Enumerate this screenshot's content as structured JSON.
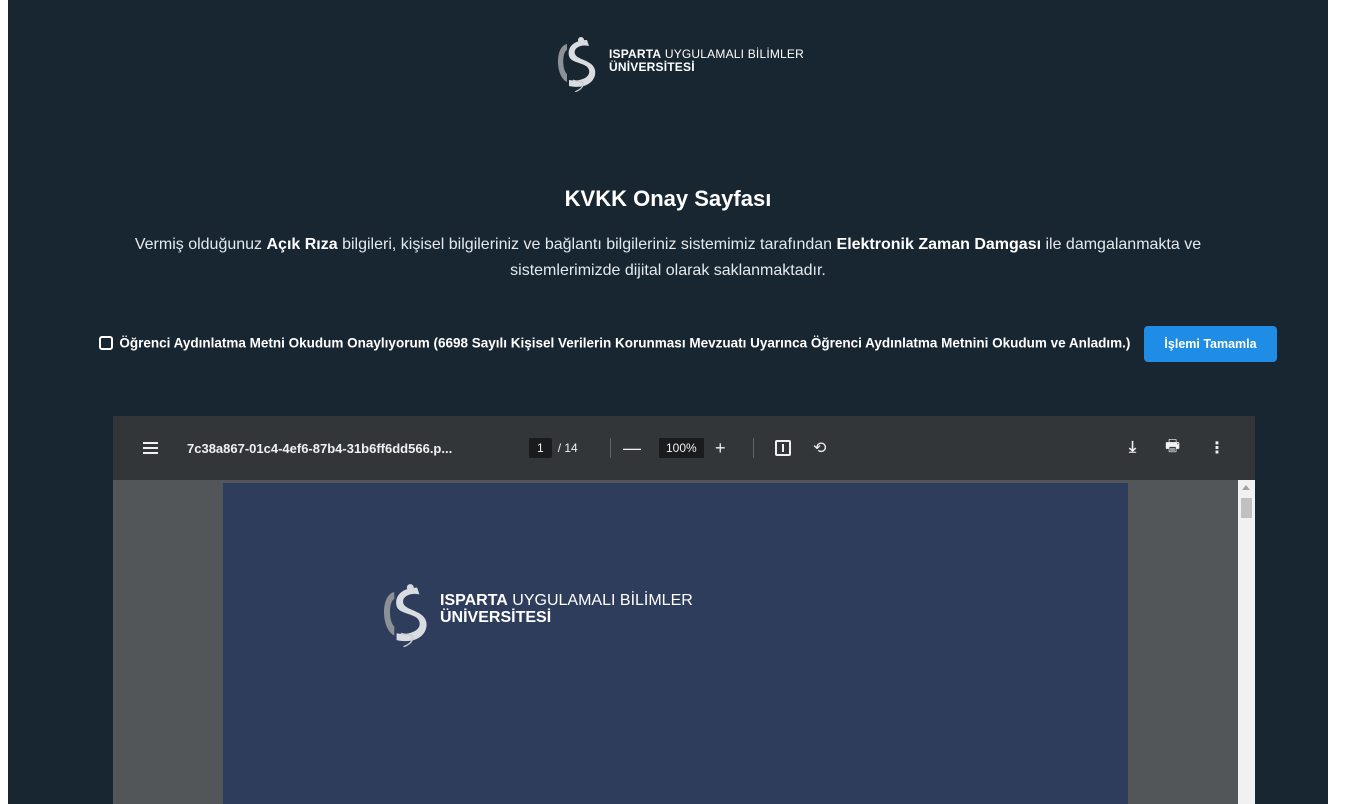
{
  "header": {
    "logo": {
      "line1_bold": "ISPARTA",
      "line1_rest": " UYGULAMALI BİLİMLER",
      "line2": "ÜNİVERSİTESİ"
    }
  },
  "main": {
    "title": "KVKK Onay Sayfası",
    "description": {
      "p1": "Vermiş olduğunuz ",
      "b1": "Açık Rıza",
      "p2": " bilgileri, kişisel bilgileriniz ve bağlantı bilgileriniz sistemimiz tarafından ",
      "b2": "Elektronik Zaman Damgası",
      "p3": " ile damgalanmakta ve sistemlerimizde dijital olarak saklanmaktadır."
    },
    "consent_label": "Öğrenci Aydınlatma Metni Okudum Onaylıyorum (6698 Sayılı Kişisel Verilerin Korunması Mevzuatı Uyarınca Öğrenci Aydınlatma Metnini Okudum ve Anladım.)",
    "submit_button": "İşlemi Tamamla"
  },
  "pdf_viewer": {
    "filename": "7c38a867-01c4-4ef6-87b4-31b6ff6dd566.p...",
    "current_page": "1",
    "total_pages": "/ 14",
    "zoom": "100%",
    "zoom_out": "—",
    "zoom_in": "+",
    "rotate_glyph": "⟲",
    "download_glyph": "⤓",
    "print_glyph": "🖶",
    "more_glyph": "⋮",
    "icons": [
      "menu-icon",
      "zoom-out-icon",
      "zoom-in-icon",
      "fit-page-icon",
      "rotate-icon",
      "download-icon",
      "print-icon",
      "more-options-icon"
    ],
    "page_logo": {
      "line1_bold": "ISPARTA",
      "line1_rest": " UYGULAMALI BİLİMLER",
      "line2": "ÜNİVERSİTESİ"
    }
  },
  "colors": {
    "background": "#182631",
    "button": "#1f8de6",
    "pdf_page": "#2e3d5c",
    "toolbar": "#323639"
  }
}
